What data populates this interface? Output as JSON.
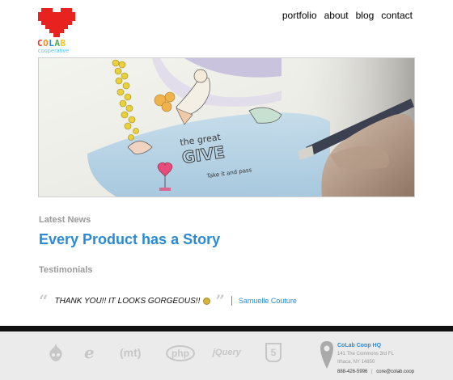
{
  "brand": {
    "name": "COLAB",
    "tagline": "cooperative",
    "letter_colors": [
      "#e8342a",
      "#f08a1c",
      "#2a8ad6",
      "#4cae4c",
      "#f0c419"
    ],
    "heart_color": "#e8221e"
  },
  "nav": {
    "items": [
      {
        "label": "portfolio"
      },
      {
        "label": "about"
      },
      {
        "label": "blog"
      },
      {
        "label": "contact"
      }
    ]
  },
  "hero": {
    "illustration_text": [
      "the great",
      "GIVE",
      "Take it and pass"
    ]
  },
  "latest_news": {
    "heading": "Latest News",
    "headline": "Every Product has a Story"
  },
  "testimonials": {
    "heading": "Testimonials",
    "open_quote": "“",
    "close_quote": "”",
    "quote": "THANK YOU!! IT LOOKS GORGEOUS!!",
    "author": "Samuelle Couture"
  },
  "footer": {
    "tech_icons": [
      {
        "icon": "drupal-icon",
        "label": ""
      },
      {
        "icon": "ie-icon",
        "label": "e"
      },
      {
        "icon": "movable-type-icon",
        "label": "(mt)"
      },
      {
        "icon": "php-icon",
        "label": "php"
      },
      {
        "icon": "jquery-icon",
        "label": "jQuery"
      },
      {
        "icon": "html5-icon",
        "label": "5"
      }
    ],
    "contact": {
      "title": "CoLab Coop HQ",
      "address_line1": "141 The Commons 3rd FL",
      "address_line2": "Ithaca, NY 14850",
      "phone": "888-426-5996",
      "email": "core@colab.coop"
    }
  },
  "colors": {
    "accent": "#2a8ad6",
    "muted": "#9a9a9a",
    "footer_bg": "#ebebeb",
    "footer_bar": "#111111"
  }
}
